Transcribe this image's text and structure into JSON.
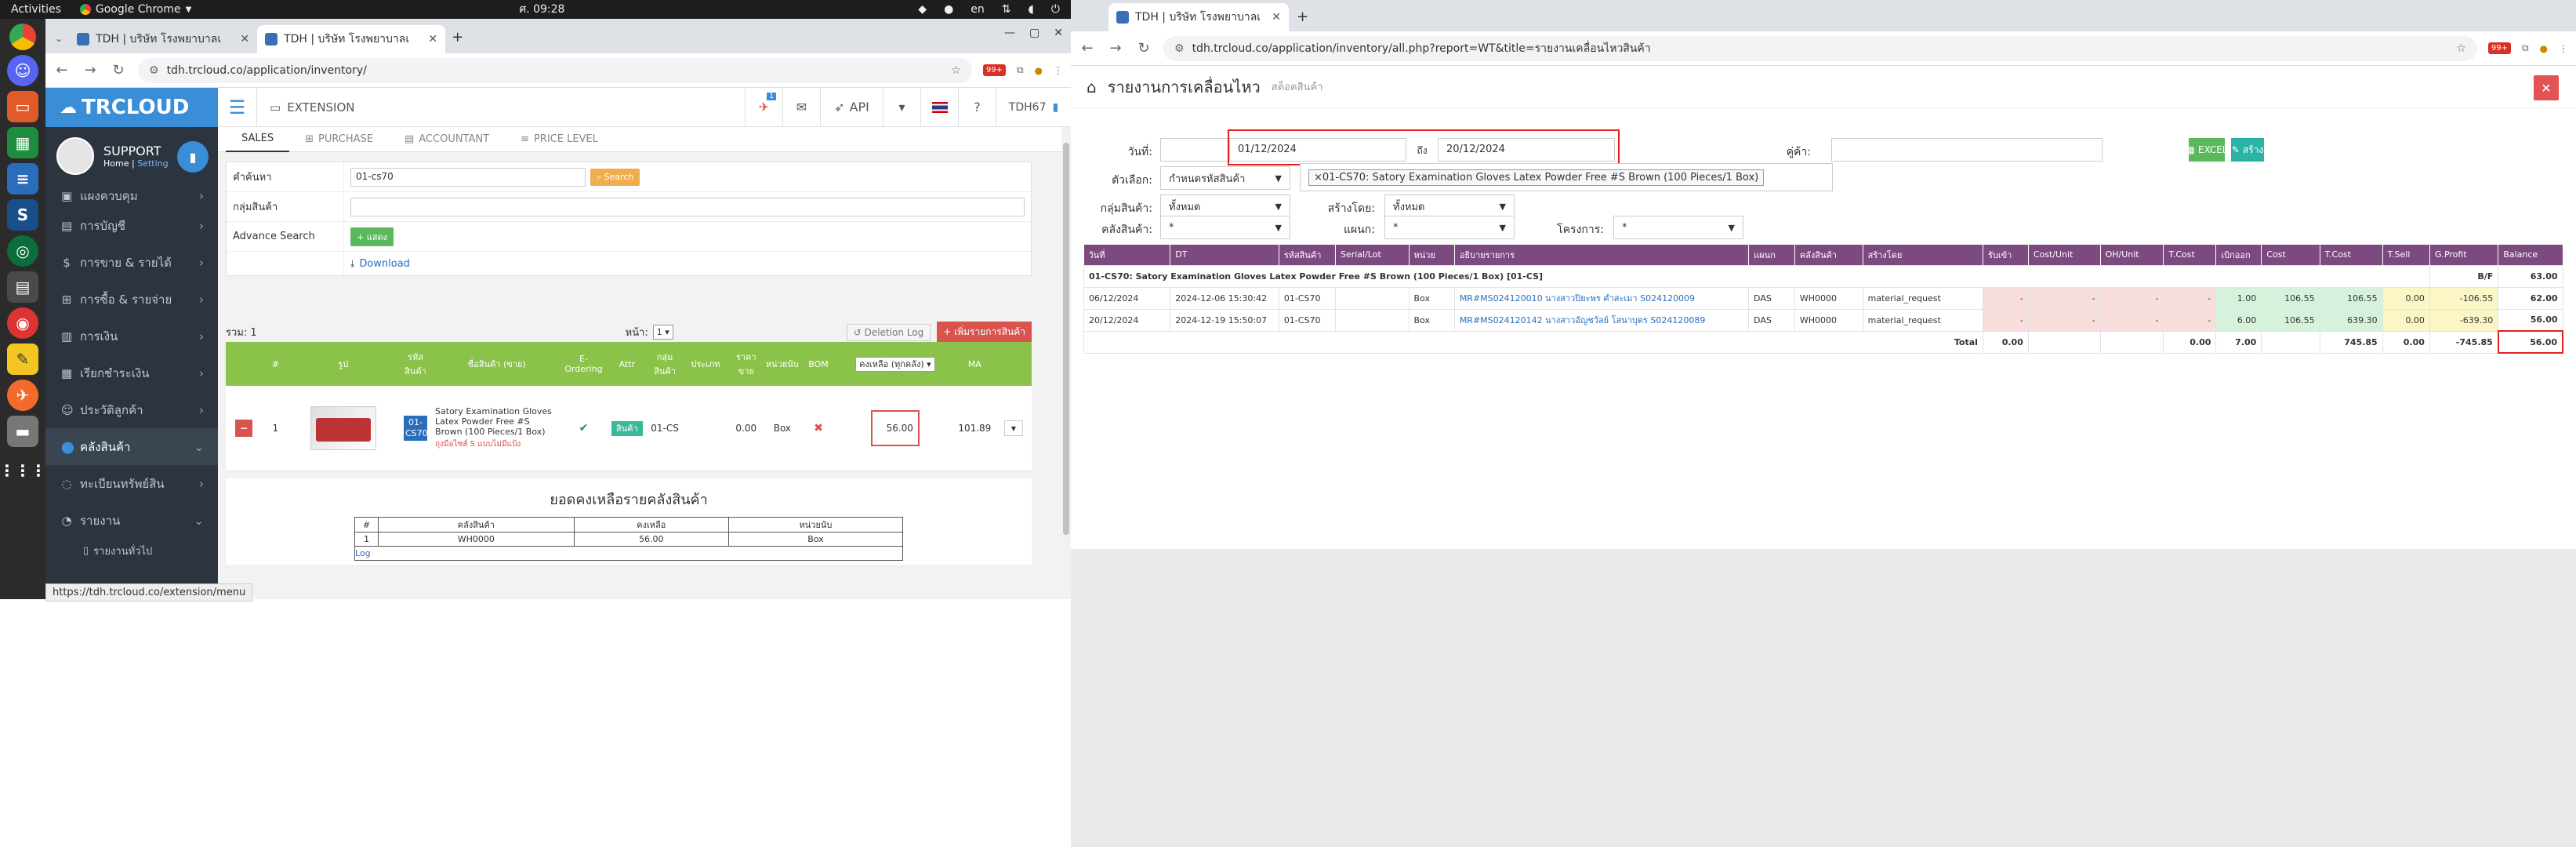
{
  "topbar": {
    "activities": "Activities",
    "app": "Google Chrome",
    "clock": "ศ. 09:28",
    "lang": "en"
  },
  "left_window": {
    "tabs": [
      {
        "label": "TDH | บริษัท โรงพยาบาลเ"
      },
      {
        "label": "TDH | บริษัท โรงพยาบาลเ"
      }
    ],
    "url": "tdh.trcloud.co/application/inventory/",
    "ext_badge": "99+",
    "logo": "TRCLOUD",
    "profile": {
      "name": "SUPPORT",
      "home": "Home",
      "sep": "|",
      "setting": "Setting"
    },
    "menu": [
      {
        "label": "แผงควบคุม"
      },
      {
        "label": "การบัญชี"
      },
      {
        "label": "การขาย & รายได้"
      },
      {
        "label": "การซื้อ & รายจ่าย"
      },
      {
        "label": "การเงิน"
      },
      {
        "label": "เรียกชำระเงิน"
      },
      {
        "label": "ประวัติลูกค้า"
      },
      {
        "label": "คลังสินค้า"
      },
      {
        "label": "ทะเบียนทรัพย์สิน"
      },
      {
        "label": "รายงาน"
      }
    ],
    "submenu": [
      {
        "label": "รายงานทั่วไป"
      }
    ],
    "status_url": "https://tdh.trcloud.co/extension/menu",
    "header": {
      "extension": "EXTENSION",
      "api": "API",
      "user": "TDH67",
      "notif_count": "1"
    },
    "subtabs": [
      {
        "label": "SALES"
      },
      {
        "label": "PURCHASE"
      },
      {
        "label": "ACCOUNTANT"
      },
      {
        "label": "PRICE LEVEL"
      }
    ],
    "search": {
      "keyword_label": "คำค้นหา",
      "keyword_value": "01-cs70",
      "search_btn": "Search",
      "group_label": "กลุ่มสินค้า",
      "advance_label": "Advance Search",
      "show_btn": "+ แสดง",
      "download": "Download"
    },
    "list": {
      "total_label": "รวม: 1",
      "page_label": "หน้า:",
      "page_value": "1",
      "deletion_log": "Deletion Log",
      "add_btn": "+ เพิ่มรายการสินค้า"
    },
    "columns": [
      "#",
      "รูป",
      "รหัสสินค้า",
      "ชื่อสินค้า (ขาย)",
      "E-Ordering",
      "Attr",
      "กลุ่มสินค้า",
      "ประเภท",
      "ราคาขาย",
      "หน่วยนับ",
      "BOM",
      "คงเหลือ (ทุกคลัง)",
      "MA"
    ],
    "row": {
      "index": "1",
      "code": "01-CS70",
      "name": "Satory Examination Gloves Latex Powder Free #S Brown (100 Pieces/1 Box)",
      "tag": "ถุงมือไซส์ S แบบไม่มีแป้ง",
      "unit_badge": "สินค้า",
      "group": "01-CS",
      "price": "0.00",
      "uom": "Box",
      "remain": "56.00",
      "ma": "101.89"
    },
    "summary": {
      "title": "ยอดคงเหลือรายคลังสินค้า",
      "headers": [
        "#",
        "คลังสินค้า",
        "คงเหลือ",
        "หน่วยนับ"
      ],
      "rows": [
        [
          "1",
          "WH0000",
          "56.00",
          "Box"
        ]
      ],
      "log": "Log"
    }
  },
  "right_window": {
    "tab": "TDH | บริษัท โรงพยาบาลเ",
    "url": "tdh.trcloud.co/application/inventory/all.php?report=WT&title=รายงานเคลื่อนไหวสินค้า",
    "title": "รายงานการเคลื่อนไหว",
    "subtitle": "สต็อคสินค้า",
    "filters": {
      "date_label": "วันที่:",
      "date_from": "01/12/2024",
      "date_to_label": "ถึง",
      "date_to": "20/12/2024",
      "customer_label": "คู่ค้า:",
      "option_label": "ตัวเลือก:",
      "option_value": "กำหนดรหัสสินค้า",
      "product_tag": "×01-CS70: Satory Examination Gloves Latex Powder Free #S Brown (100 Pieces/1 Box)",
      "group_label": "กลุ่มสินค้า:",
      "group_value": "ทั้งหมด",
      "creator_label": "สร้างโดย:",
      "creator_value": "ทั้งหมด",
      "warehouse_label": "คลังสินค้า:",
      "warehouse_value": "*",
      "dept_label": "แผนก:",
      "dept_value": "*",
      "project_label": "โครงการ:",
      "project_value": "*",
      "excel_btn": "EXCEL",
      "build_btn": "สร้าง"
    },
    "report_columns": [
      "วันที่",
      "DT",
      "รหัสสินค้า",
      "Serial/Lot",
      "หน่วย",
      "อธิบายรายการ",
      "แผนก",
      "คลังสินค้า",
      "สร้างโดย",
      "รับเข้า",
      "Cost/Unit",
      "OH/Unit",
      "T.Cost",
      "เบิกออก",
      "Cost",
      "T.Cost",
      "T.Sell",
      "G.Profit",
      "Balance"
    ],
    "product_header": "01-CS70: Satory Examination Gloves Latex Powder Free #S Brown (100 Pieces/1 Box) [01-CS]",
    "bf_label": "B/F",
    "bf_value": "63.00",
    "rows": [
      {
        "date": "06/12/2024",
        "dt": "2024-12-06 15:30:42",
        "code": "01-CS70",
        "serial": "",
        "unit": "Box",
        "desc": "MR#MS024120010 นางสาวปิยะพร คำสะเมา S024120009",
        "dept": "DAS",
        "wh": "WH0000",
        "by": "material_request",
        "in": "-",
        "cost_unit": "-",
        "oh_unit": "-",
        "tcost_in": "-",
        "out": "1.00",
        "cost": "106.55",
        "tcost": "106.55",
        "tsell": "0.00",
        "profit": "-106.55",
        "balance": "62.00"
      },
      {
        "date": "20/12/2024",
        "dt": "2024-12-19 15:50:07",
        "code": "01-CS70",
        "serial": "",
        "unit": "Box",
        "desc": "MR#MS024120142 นางสาวอัญชวัลย์ โสนาบุตร S024120089",
        "dept": "DAS",
        "wh": "WH0000",
        "by": "material_request",
        "in": "-",
        "cost_unit": "-",
        "oh_unit": "-",
        "tcost_in": "-",
        "out": "6.00",
        "cost": "106.55",
        "tcost": "639.30",
        "tsell": "0.00",
        "profit": "-639.30",
        "balance": "56.00"
      }
    ],
    "total": {
      "label": "Total",
      "in": "0.00",
      "tcost_in": "0.00",
      "out": "7.00",
      "tcost": "745.85",
      "tsell": "0.00",
      "profit": "-745.85",
      "balance": "56.00"
    }
  }
}
